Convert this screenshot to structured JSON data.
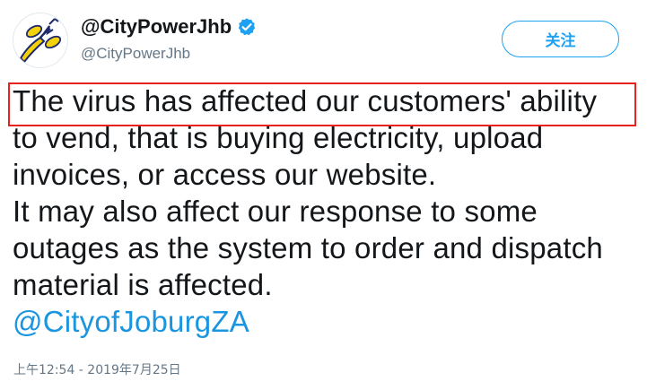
{
  "tweet": {
    "display_name": "@CityPowerJhb",
    "handle": "@CityPowerJhb",
    "follow_label": "关注",
    "text_lines": [
      "The virus has affected our customers' ability",
      "to vend, that is buying electricity, upload",
      "invoices, or access our website.",
      "It may also affect our response to some",
      "outages as the system to order and dispatch",
      "material is affected."
    ],
    "mention": "@CityofJoburgZA",
    "timestamp": "上午12:54 - 2019年7月25日"
  },
  "icons": {
    "avatar": "city-power-logo",
    "verified": "verified-badge-icon"
  },
  "colors": {
    "accent": "#1da1f2",
    "link": "#1b95e0",
    "text": "#14171a",
    "muted": "#657786",
    "highlight": "#e8231f",
    "logo_yellow": "#f5d10b",
    "logo_navy": "#1d2a6b"
  }
}
